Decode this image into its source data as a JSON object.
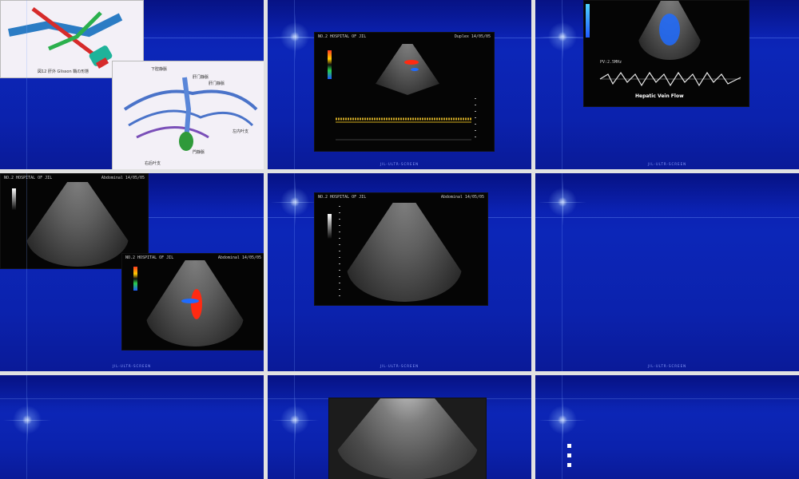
{
  "slides": [
    {
      "id": "slide-1",
      "captions": [
        "図12 肝外 Glisson 鞘の形態"
      ],
      "labels": [
        "下腔静脈",
        "肝门静脈",
        "肝门静脈",
        "門静脈",
        "右后叶支",
        "左内叶支"
      ]
    },
    {
      "id": "slide-2",
      "header_left": "NO.2 HOSPITAL OF JIL",
      "header_right": "Duplex 14/05/05"
    },
    {
      "id": "slide-3",
      "title": "Hepatic Vein Flow",
      "readout": "PV:2.5MHz"
    },
    {
      "id": "slide-4",
      "header_left": "NO.2 HOSPITAL OF JIL",
      "header_right": "Abdominal 14/05/05"
    },
    {
      "id": "slide-5",
      "header_left": "NO.2 HOSPITAL OF JIL",
      "header_right": "Abdominal 14/05/05"
    },
    {
      "id": "slide-6"
    },
    {
      "id": "slide-7"
    },
    {
      "id": "slide-8"
    },
    {
      "id": "slide-9"
    }
  ],
  "footer": "JIL-ULTR-SCREEN",
  "colors": {
    "slide_bg": "#0c24b4",
    "gap": "#e2e2e2",
    "doppler_red": "#ff2a12",
    "doppler_blue": "#1f6bff"
  }
}
